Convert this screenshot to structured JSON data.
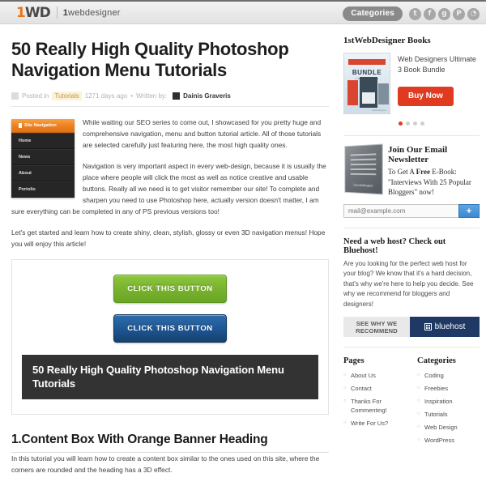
{
  "topbar": {
    "logo_mark_1": "1",
    "logo_mark_wd": "WD",
    "logo_text_bold": "1",
    "logo_text_rest": "webdesigner",
    "categories_label": "Categories",
    "social": [
      {
        "name": "twitter-icon",
        "glyph": "t"
      },
      {
        "name": "facebook-icon",
        "glyph": "f"
      },
      {
        "name": "google-plus-icon",
        "glyph": "g"
      },
      {
        "name": "pinterest-icon",
        "glyph": "P"
      },
      {
        "name": "rss-icon",
        "glyph": "◔"
      }
    ]
  },
  "post": {
    "title": "50 Really High Quality Photoshop Navigation Menu Tutorials",
    "meta": {
      "posted_in": "Posted in",
      "category": "Tutorials",
      "age": "1271 days ago",
      "separator": "•",
      "written_by": "Written by:",
      "author": "Dainis Graveris"
    },
    "nav_widget": {
      "header": "Site Navigation",
      "items": [
        "Home",
        "News",
        "About",
        "Portolio"
      ]
    },
    "paragraphs": [
      "While waiting our SEO series to come out, I showcased for you pretty huge and comprehensive navigation, menu and button tutorial article. All of those tutorials are selected carefully just featuring here, the most high quality ones.",
      "Navigation is very important aspect in every web-design, because it is usually the place where people will click the most as well as notice creative and usable buttons. Really all we need is to get visitor remember our site! To complete and sharpen you need to use Photoshop here, actually version doesn't matter, I am sure everything can be completed in any of PS previous versions too!",
      "Let's get started and learn how to create shiny, clean, stylish, glossy or even 3D navigation menus! Hope you will enjoy this article!"
    ],
    "demo": {
      "button_green": "CLICK THIS BUTTON",
      "button_blue": "CLICK THIS BUTTON",
      "caption": "50 Really High Quality Photoshop Navigation Menu Tutorials"
    },
    "section": {
      "heading": "1.Content Box With Orange Banner Heading",
      "text": "In this tutorial you will learn how to create a content box similar to the ones used on this site, where the corners are rounded and the heading has a 3D effect."
    }
  },
  "rail": {
    "books": {
      "heading": "1stWebDesigner Books",
      "cover": {
        "word": "BUNDLE",
        "sub": "3 BOOK BUNDLE",
        "foot": "1stwebdesigner"
      },
      "title": "Web Designers Ultimate 3 Book Bundle",
      "buy_label": "Buy Now",
      "dots": 4,
      "active_dot": 0
    },
    "newsletter": {
      "cover_foot": "1stwebdesigner",
      "heading": "Join Our Email Newsletter",
      "line1_a": "To Get A ",
      "line1_b": "Free",
      "line1_c": " E-Book:",
      "line2": "\"Interviews With 25 Popular Bloggers\" now!",
      "input_placeholder": "mail@example.com",
      "input_value": "",
      "submit_label": "+"
    },
    "bluehost": {
      "heading": "Need a web host? Check out Bluehost!",
      "text": "Are you looking for the perfect web host for your blog? We know that it's a hard decision, that's why we're here to help you decide. See why we recommend for bloggers and designers!",
      "button_label": "SEE WHY WE RECOMMEND",
      "logo_label": "bluehost"
    },
    "pages": {
      "heading": "Pages",
      "items": [
        "About Us",
        "Contact",
        "Thanks For Commenting!",
        "Write For Us?"
      ]
    },
    "categories": {
      "heading": "Categories",
      "items": [
        "Coding",
        "Freebies",
        "Inspiration",
        "Tutorials",
        "Web Design",
        "WordPress"
      ]
    }
  },
  "colors": {
    "orange": "#ee8120",
    "red": "#e03a21",
    "green": "#79b32f",
    "blue": "#1f5795",
    "bluehost_navy": "#1f3864",
    "dark": "#333333"
  }
}
